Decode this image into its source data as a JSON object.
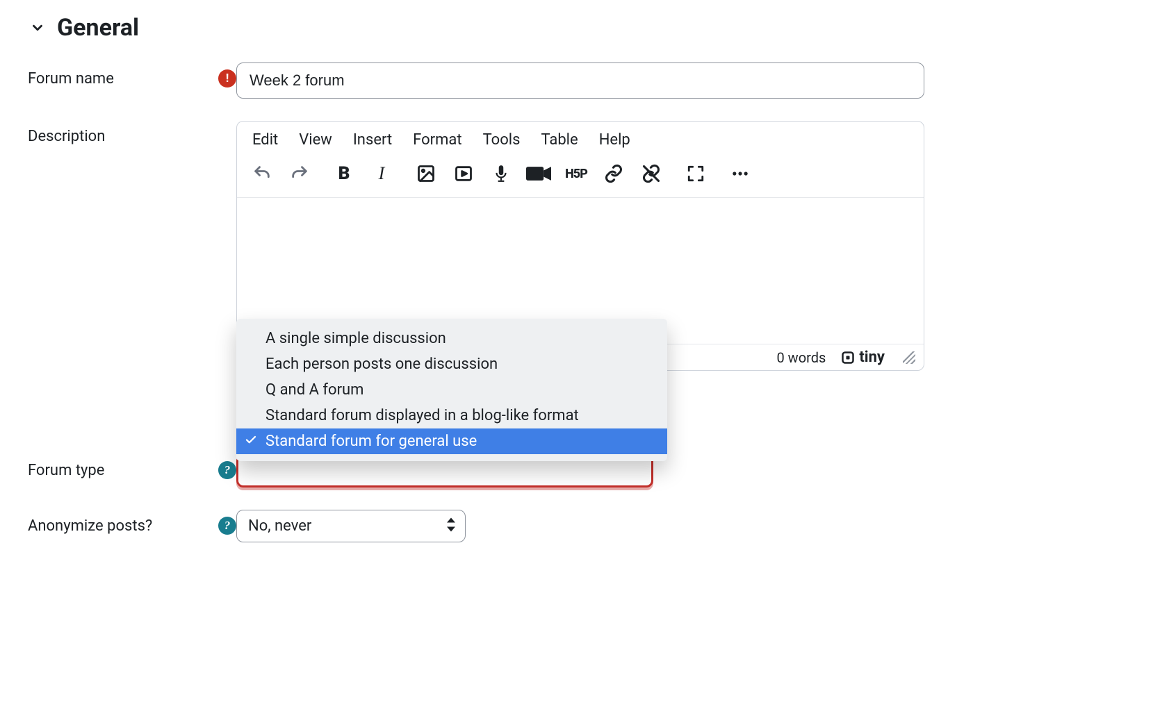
{
  "section": {
    "title": "General"
  },
  "forum_name": {
    "label": "Forum name",
    "value": "Week 2 forum",
    "required": true
  },
  "description": {
    "label": "Description",
    "menubar": {
      "edit": "Edit",
      "view": "View",
      "insert": "Insert",
      "format": "Format",
      "tools": "Tools",
      "table": "Table",
      "help": "Help"
    },
    "toolbar_icons": {
      "undo": "undo-icon",
      "redo": "redo-icon",
      "bold": "bold-icon",
      "italic": "italic-icon",
      "image": "image-icon",
      "media": "media-icon",
      "mic": "microphone-icon",
      "video": "video-camera-icon",
      "h5p": "H5P",
      "link": "link-icon",
      "unlink": "unlink-icon",
      "fullscreen": "fullscreen-icon",
      "more": "more-icon"
    },
    "footer": {
      "word_count": "0 words",
      "branding": "tiny"
    }
  },
  "forum_type": {
    "label": "Forum type",
    "options": [
      "A single simple discussion",
      "Each person posts one discussion",
      "Q and A forum",
      "Standard forum displayed in a blog-like format",
      "Standard forum for general use"
    ],
    "selected_index": 4
  },
  "anonymize": {
    "label": "Anonymize posts?",
    "value": "No, never"
  }
}
